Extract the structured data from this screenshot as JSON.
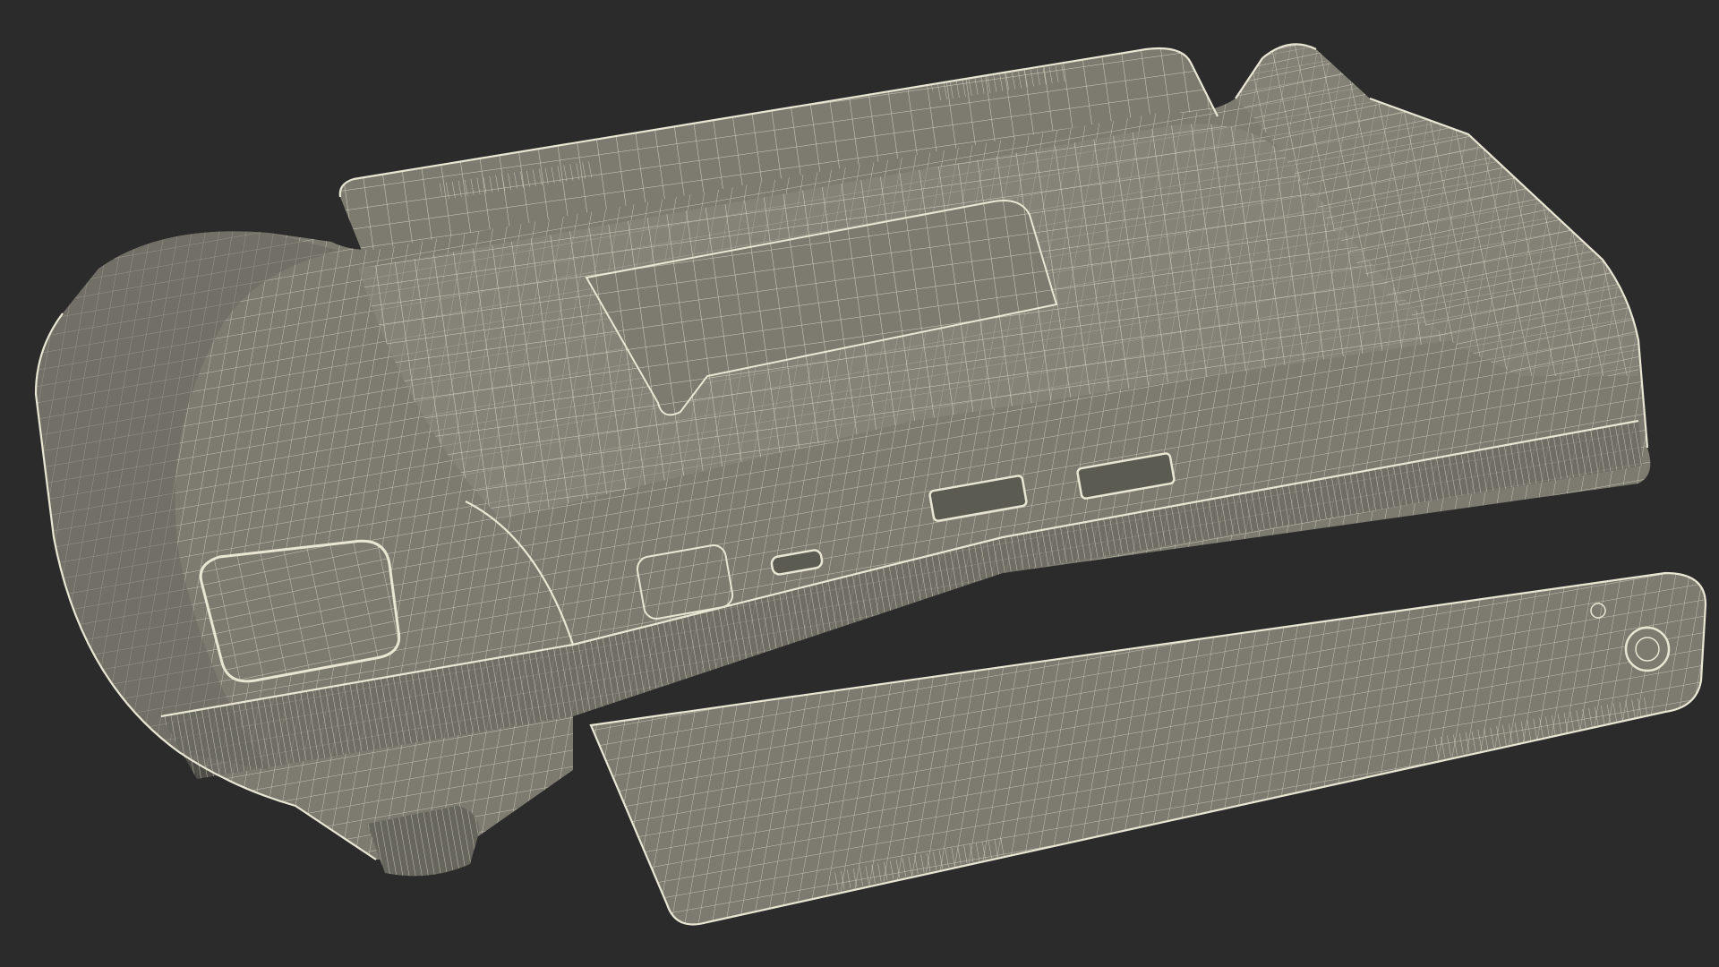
{
  "scene": {
    "subject_icon": "handheld-console-wireframe-icon",
    "colors": {
      "background": "#2b2b2b",
      "surface": "#7d7b70",
      "surface_dark": "#67665c",
      "surface_light": "#8c8a7f",
      "wire": "#e9e6d4"
    }
  }
}
